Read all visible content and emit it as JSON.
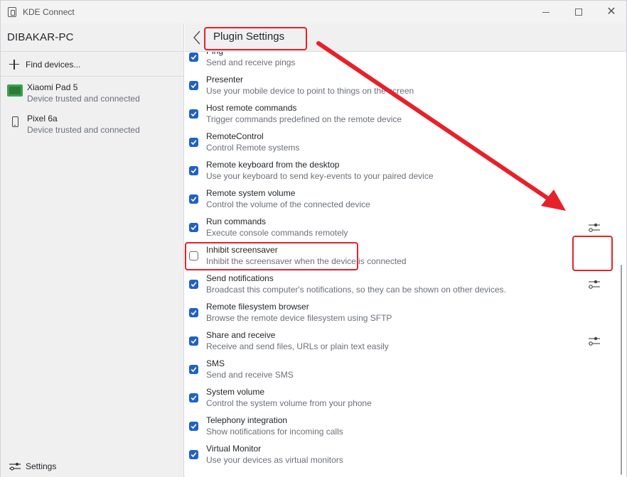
{
  "window": {
    "title": "KDE Connect"
  },
  "sidebar": {
    "header": "DIBAKAR-PC",
    "find_devices": "Find devices...",
    "devices": [
      {
        "name": "Xiaomi Pad 5",
        "status": "Device trusted and connected",
        "icon": "tablet-icon"
      },
      {
        "name": "Pixel 6a",
        "status": "Device trusted and connected",
        "icon": "phone-icon"
      }
    ],
    "settings_label": "Settings"
  },
  "main": {
    "title": "Plugin Settings",
    "plugins": [
      {
        "name": "Ping",
        "desc": "Send and receive pings",
        "checked": true,
        "configurable": false
      },
      {
        "name": "Presenter",
        "desc": "Use your mobile device to point to things on the screen",
        "checked": true,
        "configurable": false
      },
      {
        "name": "Host remote commands",
        "desc": "Trigger commands predefined on the remote device",
        "checked": true,
        "configurable": false
      },
      {
        "name": "RemoteControl",
        "desc": "Control Remote systems",
        "checked": true,
        "configurable": false
      },
      {
        "name": "Remote keyboard from the desktop",
        "desc": "Use your keyboard to send key-events to your paired device",
        "checked": true,
        "configurable": false
      },
      {
        "name": "Remote system volume",
        "desc": "Control the volume of the connected device",
        "checked": true,
        "configurable": false
      },
      {
        "name": "Run commands",
        "desc": "Execute console commands remotely",
        "checked": true,
        "configurable": true
      },
      {
        "name": "Inhibit screensaver",
        "desc": "Inhibit the screensaver when the device is connected",
        "checked": false,
        "configurable": false
      },
      {
        "name": "Send notifications",
        "desc": "Broadcast this computer's notifications, so they can be shown on other devices.",
        "checked": true,
        "configurable": true
      },
      {
        "name": "Remote filesystem browser",
        "desc": "Browse the remote device filesystem using SFTP",
        "checked": true,
        "configurable": false
      },
      {
        "name": "Share and receive",
        "desc": "Receive and send files, URLs or plain text easily",
        "checked": true,
        "configurable": true
      },
      {
        "name": "SMS",
        "desc": "Send and receive SMS",
        "checked": true,
        "configurable": false
      },
      {
        "name": "System volume",
        "desc": "Control the system volume from your phone",
        "checked": true,
        "configurable": false
      },
      {
        "name": "Telephony integration",
        "desc": "Show notifications for incoming calls",
        "checked": true,
        "configurable": false
      },
      {
        "name": "Virtual Monitor",
        "desc": "Use your devices as virtual monitors",
        "checked": true,
        "configurable": false
      }
    ]
  },
  "colors": {
    "accent": "#1e62c4",
    "highlight": "#e8202a"
  }
}
